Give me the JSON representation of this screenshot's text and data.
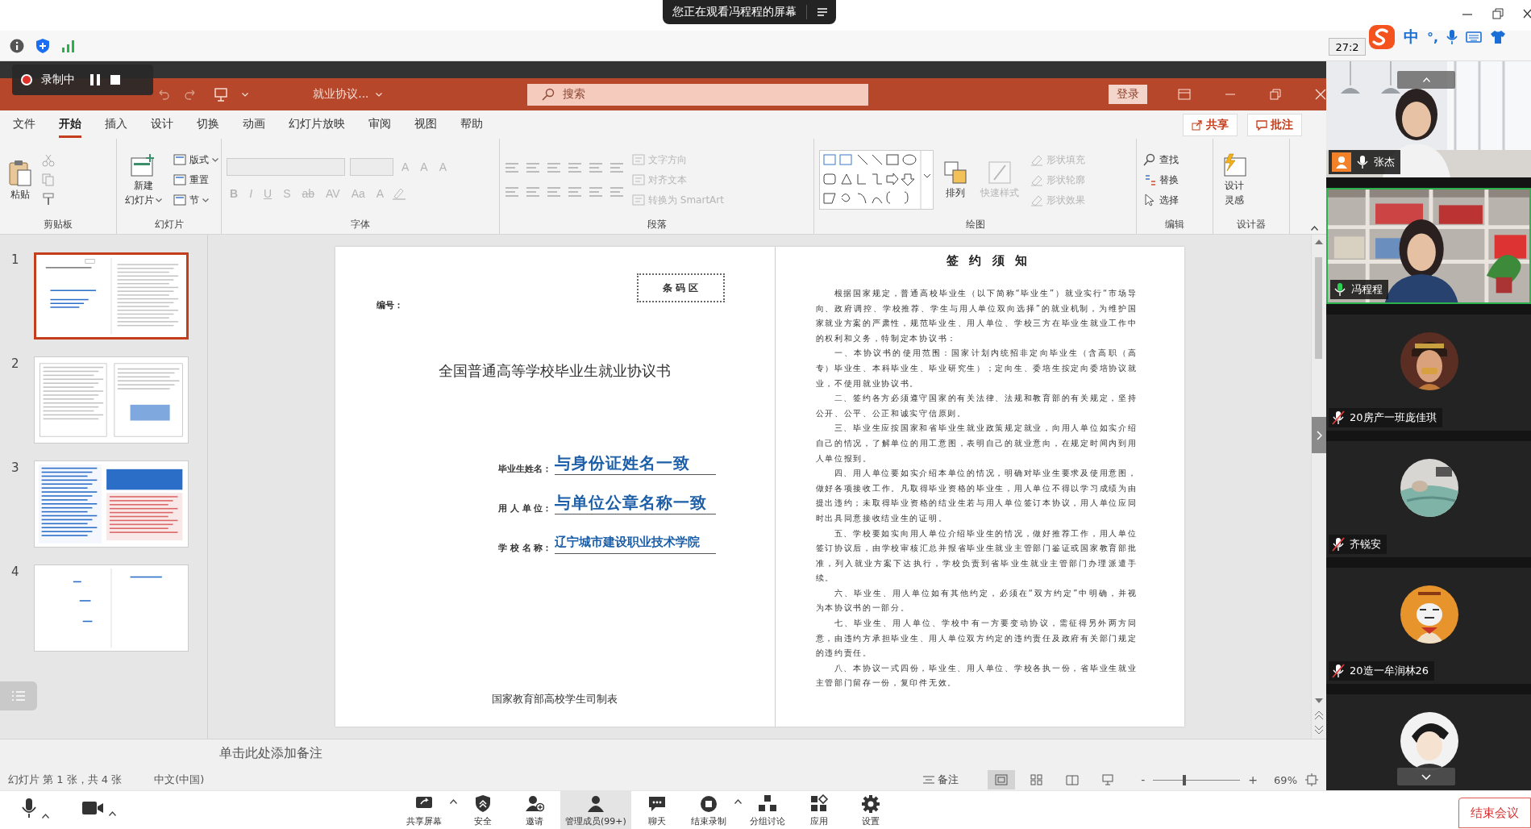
{
  "topbar": {
    "banner": "您正在观看冯程程的屏幕"
  },
  "meeting_timer": "27:2",
  "ime": {
    "mode": "中",
    "punctuation": "°,"
  },
  "recording": {
    "label": "录制中"
  },
  "powerpoint": {
    "title": "就业协议...",
    "search": {
      "placeholder": "搜索"
    },
    "login": "登录",
    "menu": [
      {
        "label": "文件",
        "selected": false
      },
      {
        "label": "开始",
        "selected": true
      },
      {
        "label": "插入",
        "selected": false
      },
      {
        "label": "设计",
        "selected": false
      },
      {
        "label": "切换",
        "selected": false
      },
      {
        "label": "动画",
        "selected": false
      },
      {
        "label": "幻灯片放映",
        "selected": false
      },
      {
        "label": "审阅",
        "selected": false
      },
      {
        "label": "视图",
        "selected": false
      },
      {
        "label": "帮助",
        "selected": false
      }
    ],
    "share": "共享",
    "comments": "批注",
    "ribbon": [
      {
        "label": "剪贴板",
        "items": [
          {
            "kind": "large",
            "label": "粘贴",
            "disabled": false
          }
        ]
      },
      {
        "label": "幻灯片",
        "items": [
          {
            "kind": "large",
            "lines": [
              "新建",
              "幻灯片"
            ],
            "disabled": false
          },
          {
            "kind": "small",
            "label": "版式",
            "disabled": false
          },
          {
            "kind": "small",
            "label": "重置",
            "disabled": false
          },
          {
            "kind": "small",
            "label": "节",
            "disabled": false
          }
        ]
      },
      {
        "label": "字体",
        "items": [
          {
            "kind": "glyph",
            "label": "A",
            "disabled": true
          },
          {
            "kind": "glyph",
            "label": "A",
            "disabled": true
          },
          {
            "kind": "glyph",
            "label": "A",
            "disabled": true
          },
          {
            "kind": "glyph",
            "label": "B",
            "disabled": true
          },
          {
            "kind": "glyph",
            "label": "I",
            "disabled": true
          },
          {
            "kind": "glyph",
            "label": "U",
            "disabled": true
          },
          {
            "kind": "glyph",
            "label": "S",
            "disabled": true
          },
          {
            "kind": "glyph",
            "label": "ab",
            "disabled": true
          },
          {
            "kind": "glyph",
            "label": "AV",
            "disabled": true
          },
          {
            "kind": "glyph",
            "label": "Aa",
            "disabled": true
          },
          {
            "kind": "glyph",
            "label": "A",
            "disabled": true
          }
        ]
      },
      {
        "label": "段落",
        "items": [
          {
            "kind": "small",
            "label": "文字方向",
            "disabled": true
          },
          {
            "kind": "small",
            "label": "对齐文本",
            "disabled": true
          },
          {
            "kind": "small",
            "label": "转换为 SmartArt",
            "disabled": true
          }
        ]
      },
      {
        "label": "绘图",
        "items": [
          {
            "kind": "large",
            "label": "排列",
            "disabled": false
          },
          {
            "kind": "large",
            "label": "快速样式",
            "disabled": true
          },
          {
            "kind": "small",
            "label": "形状填充",
            "disabled": true
          },
          {
            "kind": "small",
            "label": "形状轮廓",
            "disabled": true
          },
          {
            "kind": "small",
            "label": "形状效果",
            "disabled": true
          }
        ]
      },
      {
        "label": "编辑",
        "items": [
          {
            "kind": "small",
            "label": "查找",
            "disabled": false
          },
          {
            "kind": "small",
            "label": "替换",
            "disabled": false
          },
          {
            "kind": "small",
            "label": "选择",
            "disabled": false
          }
        ]
      },
      {
        "label": "设计器",
        "items": [
          {
            "kind": "large",
            "lines": [
              "设计",
              "灵感"
            ],
            "disabled": false
          }
        ]
      }
    ]
  },
  "slides": [
    {
      "number": "1",
      "selected": true
    },
    {
      "number": "2",
      "selected": false
    },
    {
      "number": "3",
      "selected": false
    },
    {
      "number": "4",
      "selected": false
    }
  ],
  "slide": {
    "number_label": "编号：",
    "barcode_label": "条 码 区",
    "title": "全国普通高等学校毕业生就业协议书",
    "fields": [
      {
        "label": "毕业生姓名：",
        "value": "与身份证姓名一致"
      },
      {
        "label": "用 人 单 位：",
        "value": "与单位公章名称一致"
      },
      {
        "label": "学 校 名 称：",
        "value": "辽宁城市建设职业技术学院"
      }
    ],
    "issuer": "国家教育部高校学生司制表",
    "notice_title": "签 约 须 知",
    "notice_paragraphs": [
      "根据国家规定，普通高校毕业生（以下简称“毕业生”）就业实行“市场导向、政府调控、学校推荐、学生与用人单位双向选择”的就业机制，为维护国家就业方案的严肃性，规范毕业生、用人单位、学校三方在毕业生就业工作中的权利和义务，特制定本协议书：",
      "一、本协议书的使用范围：国家计划内统招非定向毕业生（含高职（高专）毕业生、本科毕业生、毕业研究生）；定向生、委培生按定向委培协议就业，不使用就业协议书。",
      "二、签约各方必须遵守国家的有关法律、法规和教育部的有关规定，坚持公开、公平、公正和诚实守信原则。",
      "三、毕业生应按国家和省毕业生就业政策规定就业，向用人单位如实介绍自己的情况，了解单位的用工意图，表明自己的就业意向，在规定时间内到用人单位报到。",
      "四、用人单位要如实介绍本单位的情况，明确对毕业生要求及使用意图，做好各项接收工作。凡取得毕业资格的毕业生，用人单位不得以学习成绩为由提出违约；未取得毕业资格的结业生若与用人单位签订本协议，用人单位应同时出具同意接收结业生的证明。",
      "五、学校要如实向用人单位介绍毕业生的情况，做好推荐工作，用人单位签订协议后，由学校审核汇总并报省毕业生就业主管部门鉴证或国家教育部批准，列入就业方案下达执行，学校负责到省毕业生就业主管部门办理派遣手续。",
      "六、毕业生、用人单位如有其他约定，必须在“双方约定”中明确，并视为本协议书的一部分。",
      "七、毕业生、用人单位、学校中有一方要变动协议，需征得另外两方同意，由违约方承担毕业生、用人单位双方约定的违约责任及政府有关部门规定的违约责任。",
      "八、本协议一式四份，毕业生、用人单位、学校各执一份，省毕业生就业主管部门留存一份，复印件无效。"
    ]
  },
  "notes": {
    "placeholder": "单击此处添加备注"
  },
  "status_bar": {
    "slide_info": "幻灯片 第 1 张，共 4 张",
    "language": "中文(中国)",
    "notes_button": "备注",
    "views": [
      {
        "selected": true
      },
      {
        "selected": false
      },
      {
        "selected": false
      },
      {
        "selected": false
      }
    ],
    "zoom_out": "-",
    "zoom": {
      "level": 0.34
    },
    "zoom_in": "+",
    "zoom_value": "69%"
  },
  "participants": [
    {
      "kind": "video",
      "name": "张杰",
      "muted": false,
      "host": true,
      "speaking": false
    },
    {
      "kind": "video",
      "name": "冯程程",
      "muted": false,
      "host": false,
      "speaking": true
    },
    {
      "kind": "avatar",
      "name": "20房产一班庞佳琪",
      "muted": true,
      "host": false,
      "speaking": false
    },
    {
      "kind": "avatar",
      "name": "齐锐安",
      "muted": true,
      "host": false,
      "speaking": false
    },
    {
      "kind": "avatar",
      "name": "20造一牟润林26",
      "muted": true,
      "host": false,
      "speaking": false
    },
    {
      "kind": "avatar",
      "speaking": false
    }
  ],
  "meeting_toolbar": {
    "items": [
      {
        "label": "共享屏幕",
        "caret": true,
        "highlighted": false
      },
      {
        "label": "安全",
        "caret": false,
        "highlighted": false
      },
      {
        "label": "邀请",
        "caret": false,
        "highlighted": false
      },
      {
        "label": "管理成员(99+)",
        "caret": false,
        "highlighted": true
      },
      {
        "label": "聊天",
        "caret": false,
        "highlighted": false
      },
      {
        "label": "结束录制",
        "caret": true,
        "highlighted": false
      },
      {
        "label": "分组讨论",
        "caret": false,
        "highlighted": false
      },
      {
        "label": "应用",
        "caret": false,
        "highlighted": false
      },
      {
        "label": "设置",
        "caret": false,
        "highlighted": false
      }
    ],
    "end_button": "结束会议"
  }
}
